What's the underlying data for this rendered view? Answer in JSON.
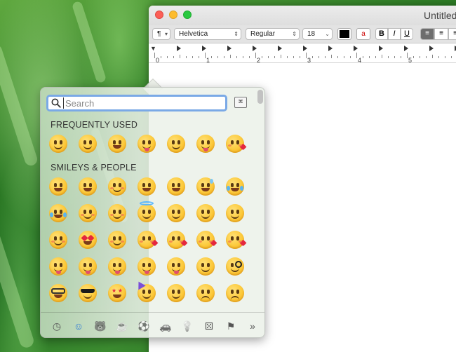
{
  "window": {
    "title": "Untitled",
    "toolbar": {
      "paragraph_symbol": "¶",
      "font_family": "Helvetica",
      "font_style": "Regular",
      "font_size": "18",
      "text_color": "#000000",
      "bold": "B",
      "italic": "I",
      "underline": "U"
    },
    "ruler_numbers": [
      "0",
      "1",
      "2",
      "3",
      "4",
      "5"
    ]
  },
  "picker": {
    "search": {
      "placeholder": "Search",
      "value": ""
    },
    "sections": [
      {
        "title": "FREQUENTLY USED",
        "rows": [
          [
            "slightly-smiling-face",
            "upside-down-face",
            "grinning-squinting-face",
            "winking-face-with-tongue",
            "face-with-raised-eyebrow",
            "zany-face",
            "face-blowing-a-kiss"
          ]
        ]
      },
      {
        "title": "SMILEYS & PEOPLE",
        "rows": [
          [
            "grinning-face",
            "grinning-face-with-big-eyes",
            "grinning-face-with-smiling-eyes",
            "beaming-face",
            "grinning-squinting-face",
            "grinning-face-with-sweat",
            "face-with-tears-of-joy"
          ],
          [
            "rolling-on-the-floor-laughing",
            "smiling-face",
            "smiling-face-with-smiling-eyes",
            "smiling-face-with-halo",
            "slightly-smiling-face",
            "upside-down-face",
            "winking-face"
          ],
          [
            "relieved-face",
            "smiling-face-with-heart-eyes",
            "smiling-face-with-hearts",
            "face-blowing-a-kiss",
            "kissing-face",
            "kissing-face-with-smiling-eyes",
            "kissing-face-with-closed-eyes"
          ],
          [
            "face-savoring-food",
            "face-with-tongue",
            "squinting-face-with-tongue",
            "winking-face-with-tongue",
            "zany-face",
            "face-with-raised-eyebrow",
            "face-with-monocle"
          ],
          [
            "nerd-face",
            "smiling-face-with-sunglasses",
            "star-struck",
            "partying-face",
            "smirking-face",
            "unamused-face",
            "disappointed-face"
          ]
        ]
      }
    ],
    "categories": [
      {
        "name": "frequently-used",
        "glyph": "◷",
        "active": false
      },
      {
        "name": "smileys-people",
        "glyph": "☺",
        "active": true
      },
      {
        "name": "animals-nature",
        "glyph": "🐻",
        "active": false
      },
      {
        "name": "food-drink",
        "glyph": "☕",
        "active": false
      },
      {
        "name": "activity",
        "glyph": "⚽",
        "active": false
      },
      {
        "name": "travel-places",
        "glyph": "🚗",
        "active": false
      },
      {
        "name": "objects",
        "glyph": "💡",
        "active": false
      },
      {
        "name": "symbols",
        "glyph": "⚄",
        "active": false
      },
      {
        "name": "flags",
        "glyph": "⚑",
        "active": false
      },
      {
        "name": "more",
        "glyph": "»",
        "active": false
      }
    ]
  }
}
